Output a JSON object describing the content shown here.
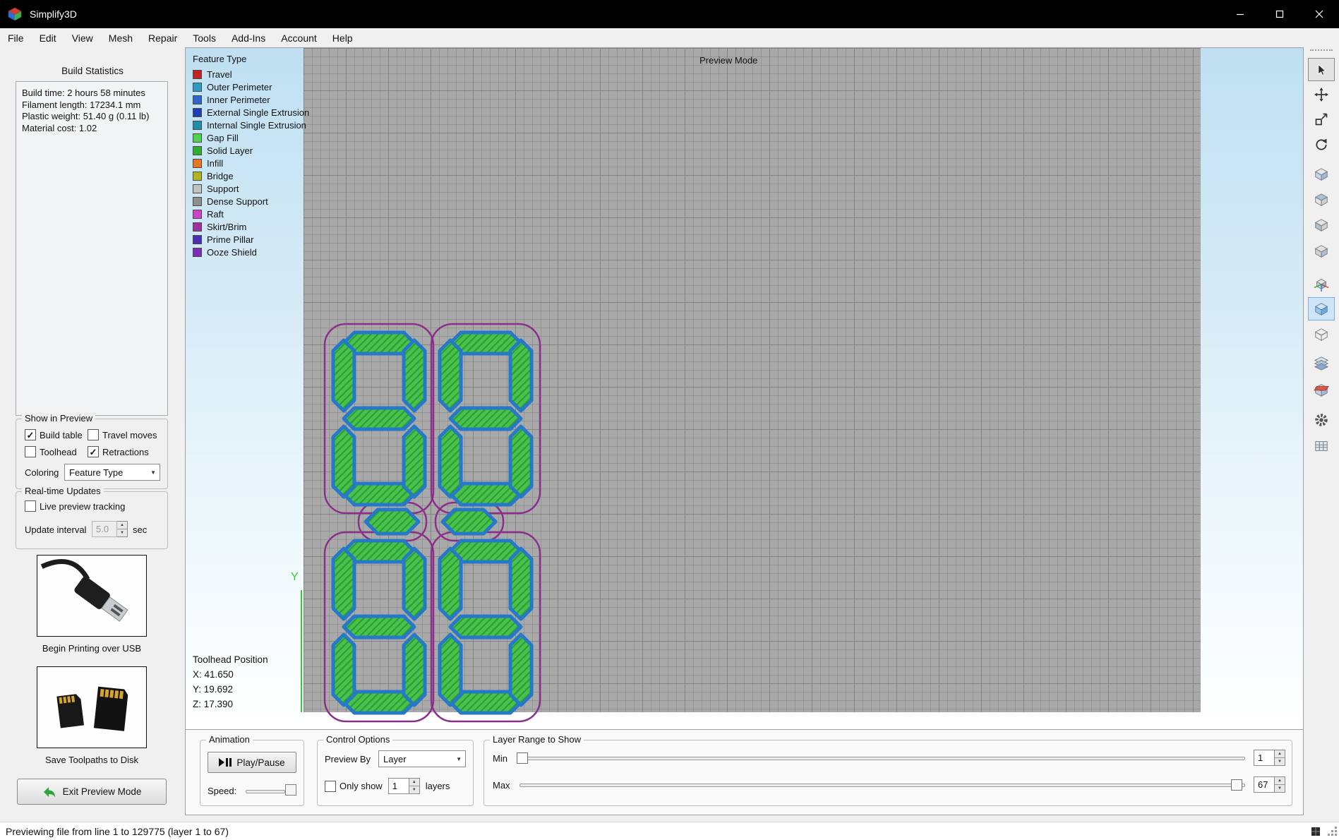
{
  "window": {
    "title": "Simplify3D"
  },
  "menu": {
    "items": [
      "File",
      "Edit",
      "View",
      "Mesh",
      "Repair",
      "Tools",
      "Add-Ins",
      "Account",
      "Help"
    ]
  },
  "icons": {
    "check": "✓",
    "dropdown_arrow": "▼",
    "spinner_up": "▲",
    "spinner_down": "▼"
  },
  "build_statistics": {
    "title": "Build Statistics",
    "lines": [
      "Build time: 2 hours 58 minutes",
      "Filament length: 17234.1 mm",
      "Plastic weight: 51.40 g (0.11 lb)",
      "Material cost: 1.02"
    ]
  },
  "show_in_preview": {
    "title": "Show in Preview",
    "checkboxes": [
      {
        "label": "Build table",
        "mark": "✓"
      },
      {
        "label": "Travel moves",
        "mark": ""
      },
      {
        "label": "Toolhead",
        "mark": ""
      },
      {
        "label": "Retractions",
        "mark": "✓"
      }
    ],
    "coloring_label": "Coloring",
    "coloring_value": "Feature Type"
  },
  "realtime_updates": {
    "title": "Real-time Updates",
    "tracking": {
      "label": "Live preview tracking",
      "mark": ""
    },
    "interval": {
      "label": "Update interval",
      "value": "5.0",
      "unit": "sec"
    }
  },
  "actions": {
    "usb_label": "Begin Printing over USB",
    "disk_label": "Save Toolpaths to Disk",
    "exit_label": "Exit Preview Mode"
  },
  "legend": {
    "title": "Feature Type",
    "items": [
      {
        "label": "Travel",
        "color": "#c32222"
      },
      {
        "label": "Outer Perimeter",
        "color": "#2f9ac4"
      },
      {
        "label": "Inner Perimeter",
        "color": "#2f64c8"
      },
      {
        "label": "External Single Extrusion",
        "color": "#1a3fb4"
      },
      {
        "label": "Internal Single Extrusion",
        "color": "#1f8fa8"
      },
      {
        "label": "Gap Fill",
        "color": "#4fd24f"
      },
      {
        "label": "Solid Layer",
        "color": "#2fae2f"
      },
      {
        "label": "Infill",
        "color": "#e8761f"
      },
      {
        "label": "Bridge",
        "color": "#b4b41f"
      },
      {
        "label": "Support",
        "color": "#c2c2c2"
      },
      {
        "label": "Dense Support",
        "color": "#8f8f8f"
      },
      {
        "label": "Raft",
        "color": "#cc44cc"
      },
      {
        "label": "Skirt/Brim",
        "color": "#a030a0"
      },
      {
        "label": "Prime Pillar",
        "color": "#4a2fb4"
      },
      {
        "label": "Ooze Shield",
        "color": "#7a2fb4"
      }
    ]
  },
  "preview": {
    "mode_label": "Preview Mode",
    "axis_y_label": "Y",
    "toolhead_position": {
      "title": "Toolhead Position",
      "x": "X: 41.650",
      "y": "Y: 19.692",
      "z": "Z: 17.390"
    }
  },
  "animation": {
    "title": "Animation",
    "play_pause_label": "Play/Pause",
    "speed_label": "Speed:"
  },
  "control_options": {
    "title": "Control Options",
    "preview_by_label": "Preview By",
    "preview_by_value": "Layer",
    "only_show": {
      "label": "Only show",
      "mark": ""
    },
    "only_show_value": "1",
    "layers_label": "layers"
  },
  "layer_range": {
    "title": "Layer Range to Show",
    "min_label": "Min",
    "min_value": "1",
    "max_label": "Max",
    "max_value": "67"
  },
  "status_bar": {
    "text": "Previewing file from line 1 to 129775 (layer 1 to 67)"
  }
}
